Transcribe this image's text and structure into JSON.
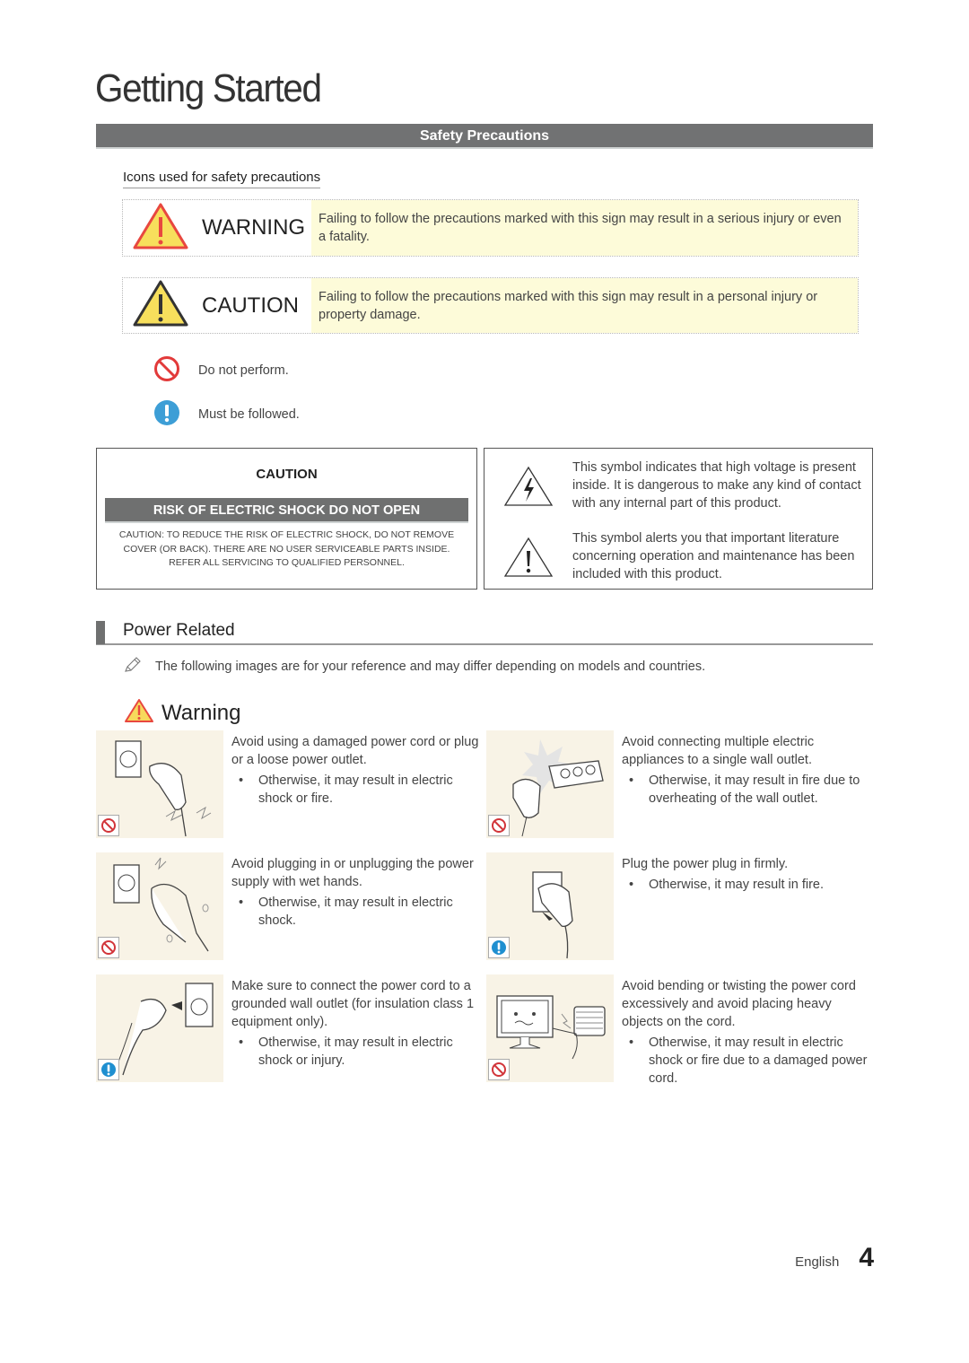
{
  "page": {
    "title": "Getting Started",
    "section_title": "Safety Precautions",
    "subheading": "Icons used for safety precautions"
  },
  "signs": [
    {
      "icon": "warning-triangle-icon",
      "word": "WARNING",
      "text": "Failing to follow the precautions marked with this sign may result in a serious injury or even a fatality."
    },
    {
      "icon": "caution-triangle-icon",
      "word": "CAUTION",
      "text": "Failing to follow the precautions marked with this sign may result in a personal injury or property damage."
    }
  ],
  "legend": [
    {
      "icon": "prohibited-icon",
      "label": "Do not perform."
    },
    {
      "icon": "exclamation-circle-icon",
      "label": "Must be followed."
    }
  ],
  "caution_box": {
    "title": "CAUTION",
    "banner": "RISK OF ELECTRIC SHOCK DO NOT OPEN",
    "lines": [
      "CAUTION: TO REDUCE THE RISK OF ELECTRIC SHOCK, DO NOT REMOVE",
      "COVER (OR BACK). THERE ARE NO USER SERVICEABLE PARTS INSIDE.",
      "REFER ALL SERVICING TO QUALIFIED PERSONNEL."
    ]
  },
  "symbols": [
    {
      "icon": "high-voltage-triangle-icon",
      "text": "This symbol indicates that high voltage is present inside. It is dangerous to make any kind of contact with any internal part of this product."
    },
    {
      "icon": "exclamation-triangle-icon",
      "text": "This symbol alerts you that important literature concerning operation and maintenance has been included with this product."
    }
  ],
  "power": {
    "heading": "Power Related",
    "note": "The following images are for your reference and may differ depending on models and countries.",
    "warning_label": "Warning",
    "items": [
      {
        "badge": "prohibited",
        "text": "Avoid using a damaged power cord or plug or a loose power outlet.",
        "bullet": "Otherwise, it may result in electric shock or fire."
      },
      {
        "badge": "prohibited",
        "text": "Avoid connecting multiple electric appliances to a single wall outlet.",
        "bullet": "Otherwise, it may result in fire due to overheating of the wall outlet."
      },
      {
        "badge": "prohibited",
        "text": "Avoid plugging in or unplugging the power supply with wet hands.",
        "bullet": "Otherwise, it may result in electric shock."
      },
      {
        "badge": "mandatory",
        "text": "Plug the power plug in firmly.",
        "bullet": "Otherwise, it may result in fire."
      },
      {
        "badge": "mandatory",
        "text": "Make sure to connect the power cord to a grounded wall outlet (for insulation class 1 equipment only).",
        "bullet": "Otherwise, it may result in electric shock or injury."
      },
      {
        "badge": "prohibited",
        "text": "Avoid bending or twisting the power cord excessively and avoid placing heavy objects on the cord.",
        "bullet": "Otherwise, it may result in electric shock or fire due to a damaged power cord."
      }
    ]
  },
  "footer": {
    "language": "English",
    "page_number": "4"
  },
  "colors": {
    "bar_gray": "#717273",
    "sign_yellow_bg": "#fdfbd9",
    "warning_red": "#e8473f",
    "caution_yellow": "#f7df5c",
    "prohibit_red": "#e23a3a",
    "mandatory_blue": "#3d9ed6",
    "picture_bg": "#f8f3e6"
  }
}
